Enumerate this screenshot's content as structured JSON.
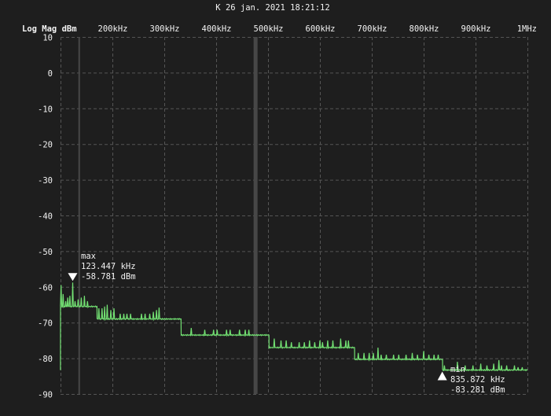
{
  "chart_data": {
    "type": "line",
    "title": "K 26 jan. 2021 18:21:12",
    "ylabel": "Log Mag dBm",
    "xlim_khz": [
      100,
      1000
    ],
    "ylim": [
      -90,
      10
    ],
    "grid": true,
    "x_ticks": [
      {
        "value": 200,
        "label": "200kHz"
      },
      {
        "value": 300,
        "label": "300kHz"
      },
      {
        "value": 400,
        "label": "400kHz"
      },
      {
        "value": 500,
        "label": "500kHz"
      },
      {
        "value": 600,
        "label": "600kHz"
      },
      {
        "value": 700,
        "label": "700kHz"
      },
      {
        "value": 800,
        "label": "800kHz"
      },
      {
        "value": 900,
        "label": "900kHz"
      },
      {
        "value": 1000,
        "label": "1MHz"
      }
    ],
    "y_ticks": [
      {
        "value": 10,
        "label": "10"
      },
      {
        "value": 0,
        "label": "0"
      },
      {
        "value": -10,
        "label": "-10"
      },
      {
        "value": -20,
        "label": "-20"
      },
      {
        "value": -30,
        "label": "-30"
      },
      {
        "value": -40,
        "label": "-40"
      },
      {
        "value": -50,
        "label": "-50"
      },
      {
        "value": -60,
        "label": "-60"
      },
      {
        "value": -70,
        "label": "-70"
      },
      {
        "value": -80,
        "label": "-80"
      },
      {
        "value": -90,
        "label": "-90"
      }
    ],
    "cursor_lines_khz": [
      136,
      476
    ],
    "trace_color": "#72e072",
    "trace_levels": [
      {
        "from": 100,
        "to": 170,
        "level": -65.5
      },
      {
        "from": 170,
        "to": 332,
        "level": -69
      },
      {
        "from": 332,
        "to": 501,
        "level": -73.5
      },
      {
        "from": 501,
        "to": 667,
        "level": -77
      },
      {
        "from": 667,
        "to": 836,
        "level": -80.3
      },
      {
        "from": 836,
        "to": 1000,
        "level": -83.3
      }
    ],
    "trace_spikes": [
      [
        101,
        -59.5
      ],
      [
        105,
        -62
      ],
      [
        110,
        -64
      ],
      [
        114,
        -63
      ],
      [
        118,
        -62.5
      ],
      [
        123.447,
        -58.781
      ],
      [
        128,
        -64
      ],
      [
        134,
        -63.5
      ],
      [
        140,
        -63
      ],
      [
        146,
        -62.5
      ],
      [
        152,
        -64
      ],
      [
        174,
        -66
      ],
      [
        180,
        -66
      ],
      [
        185,
        -65.5
      ],
      [
        190,
        -65
      ],
      [
        197,
        -66.5
      ],
      [
        203,
        -66
      ],
      [
        215,
        -67.5
      ],
      [
        222,
        -67.5
      ],
      [
        228,
        -67.5
      ],
      [
        235,
        -67.5
      ],
      [
        256,
        -67.5
      ],
      [
        263,
        -67.5
      ],
      [
        272,
        -67.5
      ],
      [
        279,
        -67
      ],
      [
        285,
        -66.5
      ],
      [
        290,
        -65.8
      ],
      [
        352,
        -71.5
      ],
      [
        378,
        -72
      ],
      [
        395,
        -72
      ],
      [
        402,
        -72
      ],
      [
        420,
        -72
      ],
      [
        427,
        -72
      ],
      [
        445,
        -72
      ],
      [
        456,
        -72
      ],
      [
        463,
        -72
      ],
      [
        512,
        -74.5
      ],
      [
        525,
        -75
      ],
      [
        535,
        -75
      ],
      [
        545,
        -75.5
      ],
      [
        560,
        -75.5
      ],
      [
        570,
        -75.5
      ],
      [
        580,
        -75
      ],
      [
        590,
        -75.5
      ],
      [
        600,
        -75
      ],
      [
        605,
        -75.5
      ],
      [
        615,
        -75
      ],
      [
        625,
        -75
      ],
      [
        640,
        -74.5
      ],
      [
        650,
        -75
      ],
      [
        655,
        -75
      ],
      [
        674,
        -78.5
      ],
      [
        685,
        -78.5
      ],
      [
        695,
        -78.5
      ],
      [
        703,
        -78.5
      ],
      [
        712,
        -77
      ],
      [
        718,
        -79
      ],
      [
        728,
        -79
      ],
      [
        742,
        -79
      ],
      [
        752,
        -79
      ],
      [
        766,
        -79
      ],
      [
        778,
        -78.5
      ],
      [
        788,
        -79
      ],
      [
        800,
        -78
      ],
      [
        810,
        -79
      ],
      [
        820,
        -79
      ],
      [
        828,
        -79
      ],
      [
        840,
        -82
      ],
      [
        865,
        -81
      ],
      [
        880,
        -82
      ],
      [
        895,
        -82
      ],
      [
        910,
        -81.5
      ],
      [
        922,
        -82
      ],
      [
        935,
        -81.5
      ],
      [
        945,
        -80.5
      ],
      [
        950,
        -82
      ],
      [
        960,
        -82
      ],
      [
        975,
        -82
      ],
      [
        982,
        -82.5
      ],
      [
        990,
        -82.5
      ]
    ],
    "markers": [
      {
        "label": "max",
        "freq": "123.447 kHz",
        "value": "-58.781 dBm",
        "freq_khz": 123.447,
        "dbm": -58.781,
        "type": "max"
      },
      {
        "label": "min",
        "freq": "835.872 kHz",
        "value": "-83.281 dBm",
        "freq_khz": 835.872,
        "dbm": -83.281,
        "type": "min"
      }
    ]
  }
}
